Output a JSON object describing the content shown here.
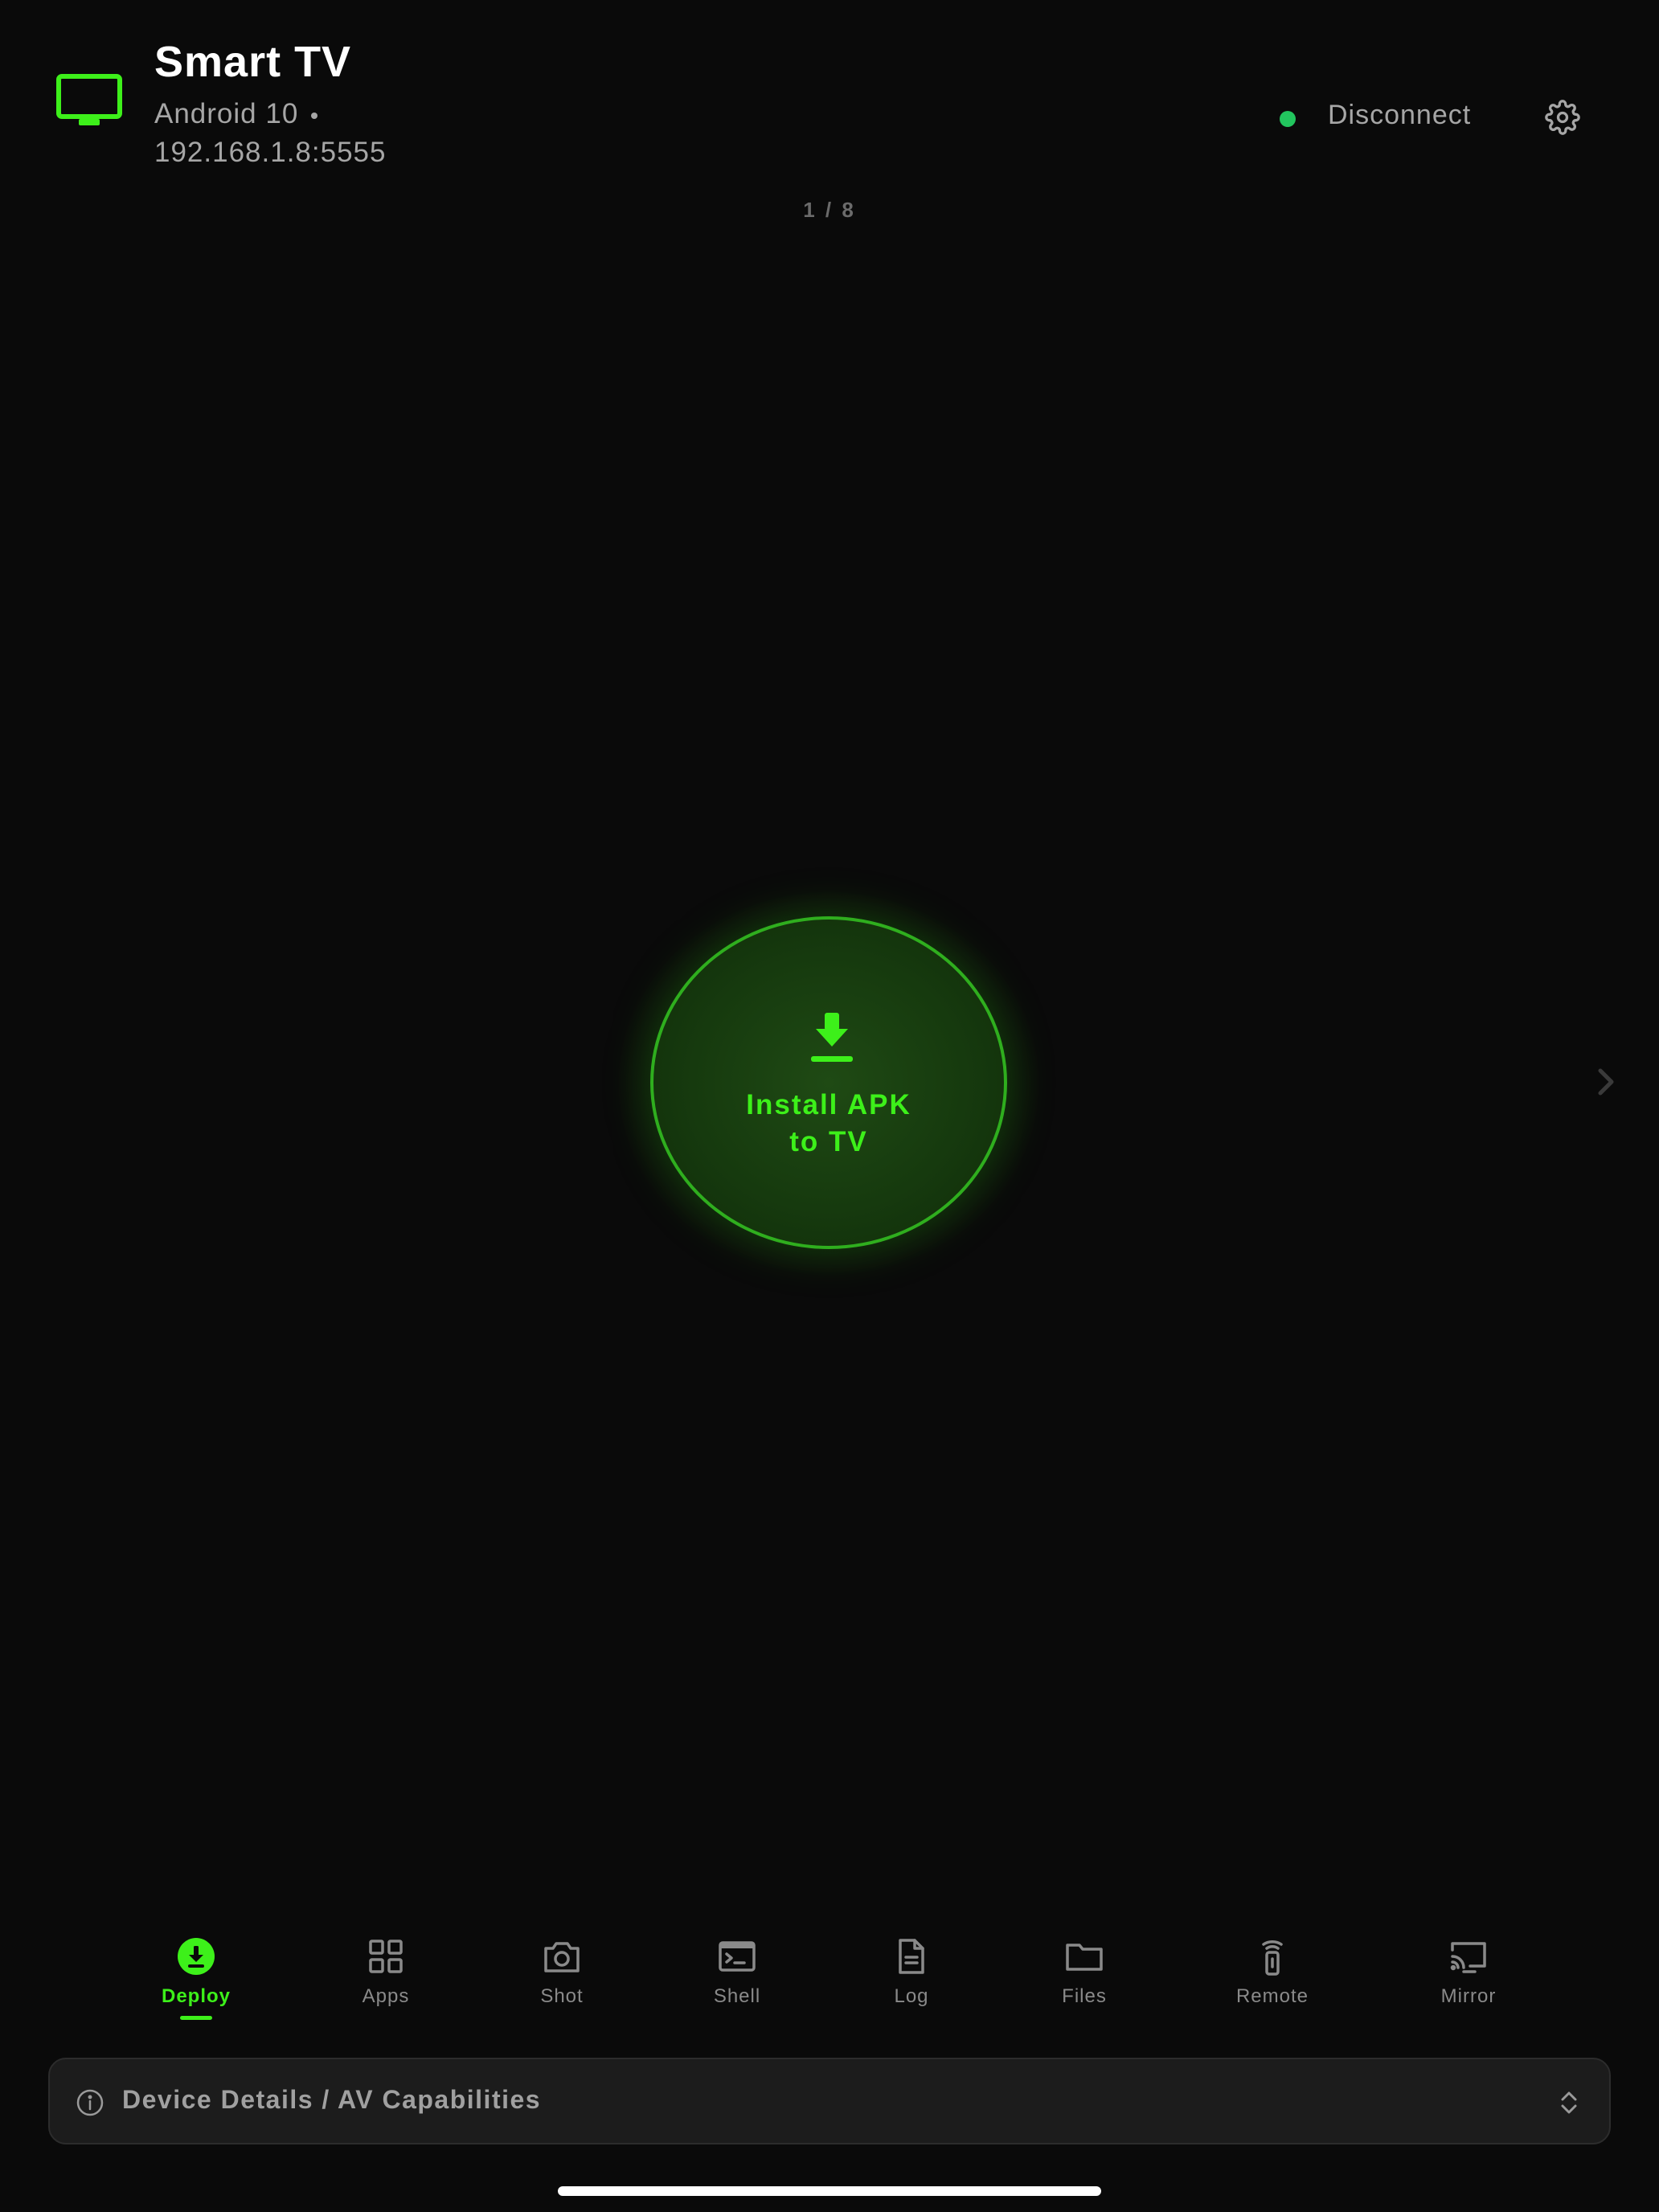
{
  "header": {
    "device_name": "Smart TV",
    "android_version": "Android 10",
    "address": "192.168.1.8:5555",
    "connection_status": "connected",
    "disconnect_label": "Disconnect"
  },
  "pager": {
    "text": "1 / 8"
  },
  "install": {
    "line1": "Install APK",
    "line2": "to TV"
  },
  "nav": {
    "items": [
      {
        "label": "Deploy",
        "icon": "download-circle-icon",
        "active": true
      },
      {
        "label": "Apps",
        "icon": "grid-icon"
      },
      {
        "label": "Shot",
        "icon": "camera-icon"
      },
      {
        "label": "Shell",
        "icon": "terminal-icon"
      },
      {
        "label": "Log",
        "icon": "document-icon"
      },
      {
        "label": "Files",
        "icon": "folder-icon"
      },
      {
        "label": "Remote",
        "icon": "remote-icon"
      },
      {
        "label": "Mirror",
        "icon": "cast-icon"
      }
    ]
  },
  "details": {
    "label": "Device Details / AV Capabilities"
  },
  "colors": {
    "accent": "#3df01a",
    "status": "#22c55e",
    "background": "#0a0a0a"
  }
}
